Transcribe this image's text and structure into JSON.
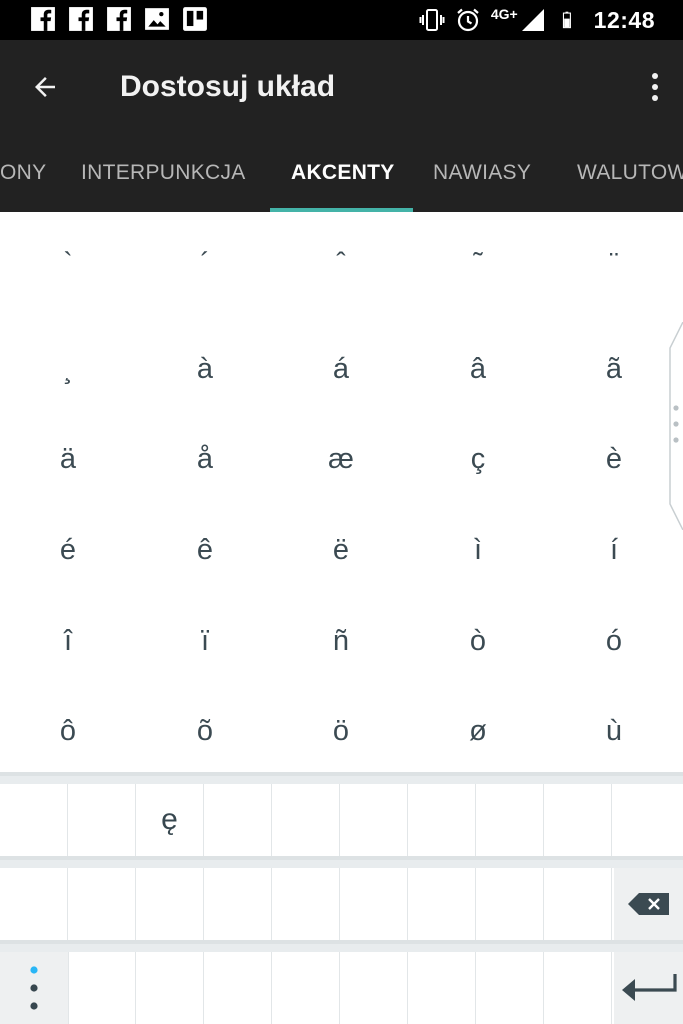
{
  "status_bar": {
    "left_icons": [
      "facebook-icon",
      "facebook-icon",
      "facebook-icon",
      "image-icon",
      "trello-icon"
    ],
    "network": "4G+",
    "time": "12:48"
  },
  "appbar": {
    "title": "Dostosuj układ"
  },
  "tabs": [
    {
      "label": "ONY",
      "active": false
    },
    {
      "label": "INTERPUNKCJA",
      "active": false
    },
    {
      "label": "AKCENTY",
      "active": true
    },
    {
      "label": "NAWIASY",
      "active": false
    },
    {
      "label": "WALUTOW",
      "active": false
    }
  ],
  "accent_grid": {
    "rows": [
      [
        "`",
        "´",
        "ˆ",
        "˜",
        "¨"
      ],
      [
        "¸",
        "à",
        "á",
        "â",
        "ã"
      ],
      [
        "ä",
        "å",
        "æ",
        "ç",
        "è"
      ],
      [
        "é",
        "ê",
        "ë",
        "ì",
        "í"
      ],
      [
        "î",
        "ï",
        "ñ",
        "ò",
        "ó"
      ],
      [
        "ô",
        "õ",
        "ö",
        "ø",
        "ù"
      ]
    ]
  },
  "keyboard": {
    "row1": [
      "",
      "",
      "ę",
      "",
      "",
      "",
      "",
      "",
      "",
      ""
    ],
    "row2": [
      "",
      "",
      "",
      "",
      "",
      "",
      "",
      "",
      "",
      "backspace-icon"
    ],
    "row3": [
      "menu-dots-icon",
      "",
      "",
      "",
      "",
      "",
      "",
      "",
      "",
      "enter-icon"
    ]
  },
  "colors": {
    "appbar": "#222222",
    "indicator": "#44b3a8",
    "accent_text": "#3b4a52",
    "dot_accent": "#29b6f6"
  }
}
